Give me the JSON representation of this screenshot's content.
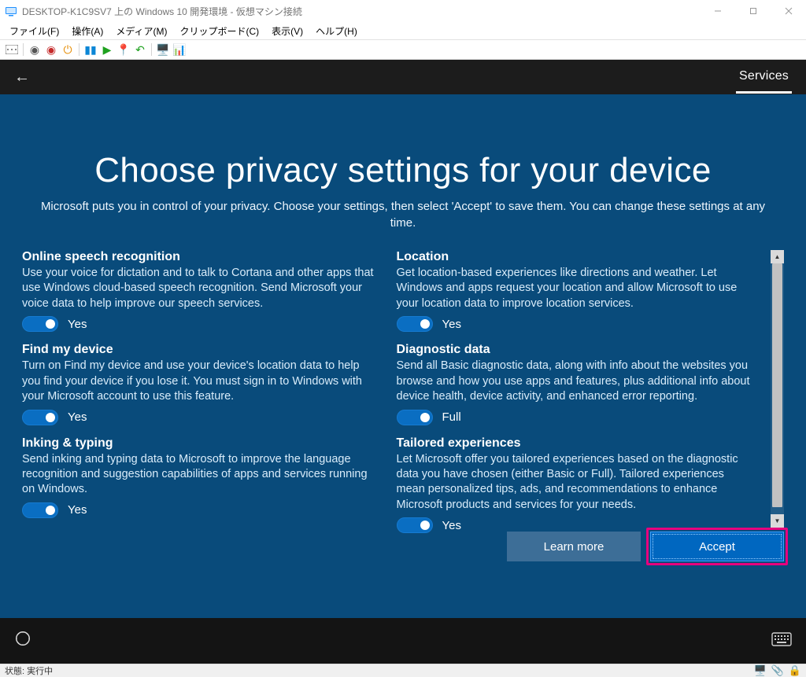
{
  "window": {
    "title": "DESKTOP-K1C9SV7 上の Windows 10 開発環境  - 仮想マシン接続"
  },
  "menubar": {
    "file": "ファイル(F)",
    "action": "操作(A)",
    "media": "メディア(M)",
    "clipboard": "クリップボード(C)",
    "view": "表示(V)",
    "help": "ヘルプ(H)"
  },
  "oobe": {
    "tab": "Services",
    "heading": "Choose privacy settings for your device",
    "subheading": "Microsoft puts you in control of your privacy. Choose your settings, then select 'Accept' to save them. You can change these settings at any time.",
    "settings_left": [
      {
        "title": "Online speech recognition",
        "desc": "Use your voice for dictation and to talk to Cortana and other apps that use Windows cloud-based speech recognition. Send Microsoft your voice data to help improve our speech services.",
        "state": "Yes"
      },
      {
        "title": "Find my device",
        "desc": "Turn on Find my device and use your device's location data to help you find your device if you lose it. You must sign in to Windows with your Microsoft account to use this feature.",
        "state": "Yes"
      },
      {
        "title": "Inking & typing",
        "desc": "Send inking and typing data to Microsoft to improve the language recognition and suggestion capabilities of apps and services running on Windows.",
        "state": "Yes"
      }
    ],
    "settings_right": [
      {
        "title": "Location",
        "desc": "Get location-based experiences like directions and weather. Let Windows and apps request your location and allow Microsoft to use your location data to improve location services.",
        "state": "Yes"
      },
      {
        "title": "Diagnostic data",
        "desc": "Send all Basic diagnostic data, along with info about the websites you browse and how you use apps and features, plus additional info about device health, device activity, and enhanced error reporting.",
        "state": "Full"
      },
      {
        "title": "Tailored experiences",
        "desc": "Let Microsoft offer you tailored experiences based on the diagnostic data you have chosen (either Basic or Full). Tailored experiences mean personalized tips, ads, and recommendations to enhance Microsoft products and services for your needs.",
        "state": "Yes"
      }
    ],
    "buttons": {
      "learn_more": "Learn more",
      "accept": "Accept"
    }
  },
  "statusbar": {
    "text": "状態: 実行中"
  }
}
